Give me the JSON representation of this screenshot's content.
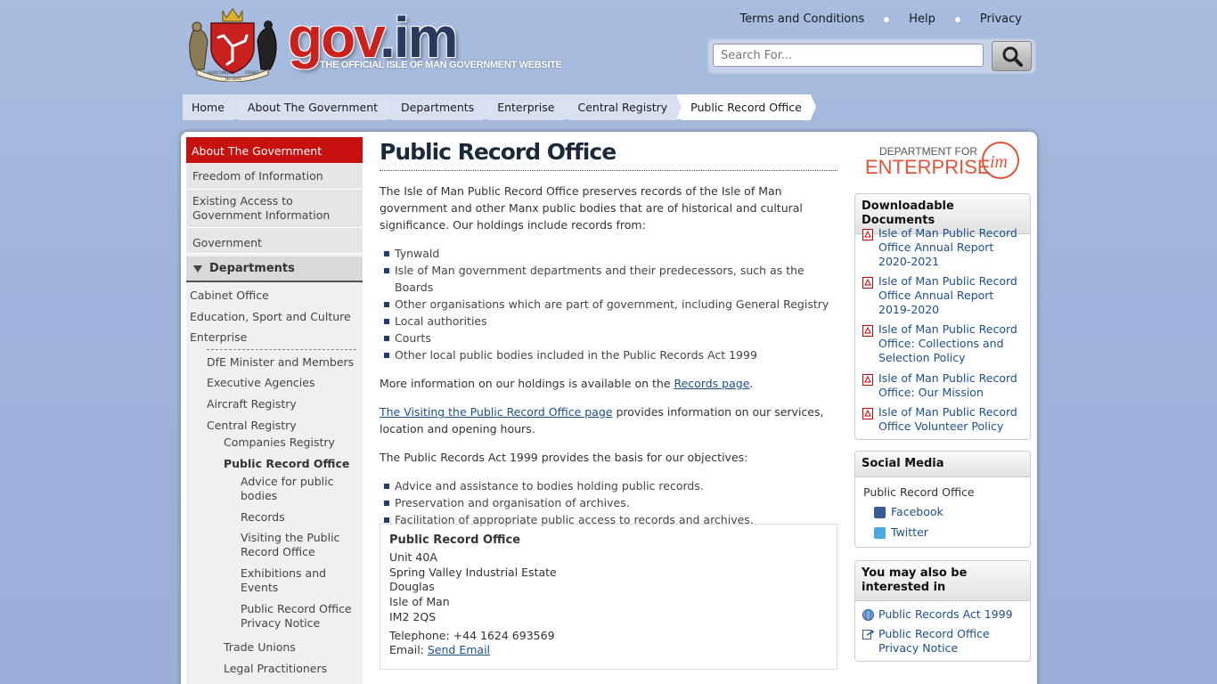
{
  "header": {
    "logo_gov": "gov",
    "logo_im": ".im",
    "tagline": "THE OFFICIAL ISLE OF MAN GOVERNMENT WEBSITE",
    "crest_motto_left": "QUOCUNQUE",
    "crest_motto_right": "STABIT",
    "crest_motto_bottom": "JECERIS",
    "links": [
      "Terms and Conditions",
      "Help",
      "Privacy"
    ],
    "search_placeholder": "Search For..."
  },
  "breadcrumb": [
    "Home",
    "About The Government",
    "Departments",
    "Enterprise",
    "Central Registry",
    "Public Record Office"
  ],
  "leftnav": {
    "head": "About The Government",
    "items": [
      "Freedom of Information",
      "Existing Access to Government Information",
      "Government"
    ],
    "departments_label": "Departments",
    "departments": [
      "Cabinet Office",
      "Education, Sport and Culture",
      "Enterprise"
    ],
    "enterprise_children": [
      "DfE Minister and Members",
      "Executive Agencies",
      "Aircraft Registry",
      "Central Registry"
    ],
    "central_registry_children": [
      "Companies Registry",
      "Public Record Office"
    ],
    "pro_children": [
      "Advice for public bodies",
      "Records",
      "Visiting the Public Record Office",
      "Exhibitions and Events",
      "Public Record Office Privacy Notice"
    ],
    "after_pro": [
      "Trade Unions",
      "Legal Practitioners"
    ]
  },
  "content": {
    "title": "Public Record Office",
    "intro": "The Isle of Man Public Record Office preserves records of the Isle of Man government and other Manx public bodies that are of historical and cultural significance. Our holdings include records from:",
    "holdings": [
      "Tynwald",
      "Isle of Man government departments and their predecessors, such as the Boards",
      "Other organisations which are part of government, including General Registry",
      "Local authorities",
      "Courts",
      "Other local public bodies included in the Public Records Act 1999"
    ],
    "more_info_pre": "More information on our holdings is available on the ",
    "more_info_link": "Records page",
    "more_info_post": ".",
    "visiting_link": "The Visiting the Public Record Office page",
    "visiting_post": " provides information on our services, location and opening hours.",
    "act_text": "The Public Records Act 1999 provides the basis for our objectives:",
    "objectives": [
      "Advice and assistance to bodies holding public records.",
      "Preservation and organisation of archives.",
      "Facilitation of appropriate public access to records and archives."
    ]
  },
  "address": {
    "name": "Public Record Office",
    "lines": [
      "Unit 40A",
      "Spring Valley Industrial Estate",
      "Douglas",
      "Isle of Man",
      "IM2 2QS"
    ],
    "telephone": "Telephone: +44 1624 693569",
    "email_label": "Email: ",
    "email_link": "Send Email"
  },
  "right": {
    "dept_logo_top": "DEPARTMENT FOR",
    "dept_logo_main": "ENTERPRISE",
    "dept_logo_mark": "im",
    "downloads_title": "Downloadable Documents",
    "downloads": [
      "Isle of Man Public Record Office Annual Report 2020-2021",
      "Isle of Man Public Record Office Annual Report 2019-2020",
      "Isle of Man Public Record Office: Collections and Selection Policy",
      "Isle of Man Public Record Office: Our Mission",
      "Isle of Man Public Record Office Volunteer Policy"
    ],
    "social_title": "Social Media",
    "social_label": "Public Record Office",
    "social": [
      "Facebook",
      "Twitter"
    ],
    "interest_title": "You may also be interested in",
    "interest": [
      "Public Records Act 1999",
      "Public Record Office Privacy Notice"
    ]
  },
  "colors": {
    "accent_red": "#c8110f",
    "link_blue": "#1d4f8a",
    "bullet_navy": "#1f3c6e"
  }
}
